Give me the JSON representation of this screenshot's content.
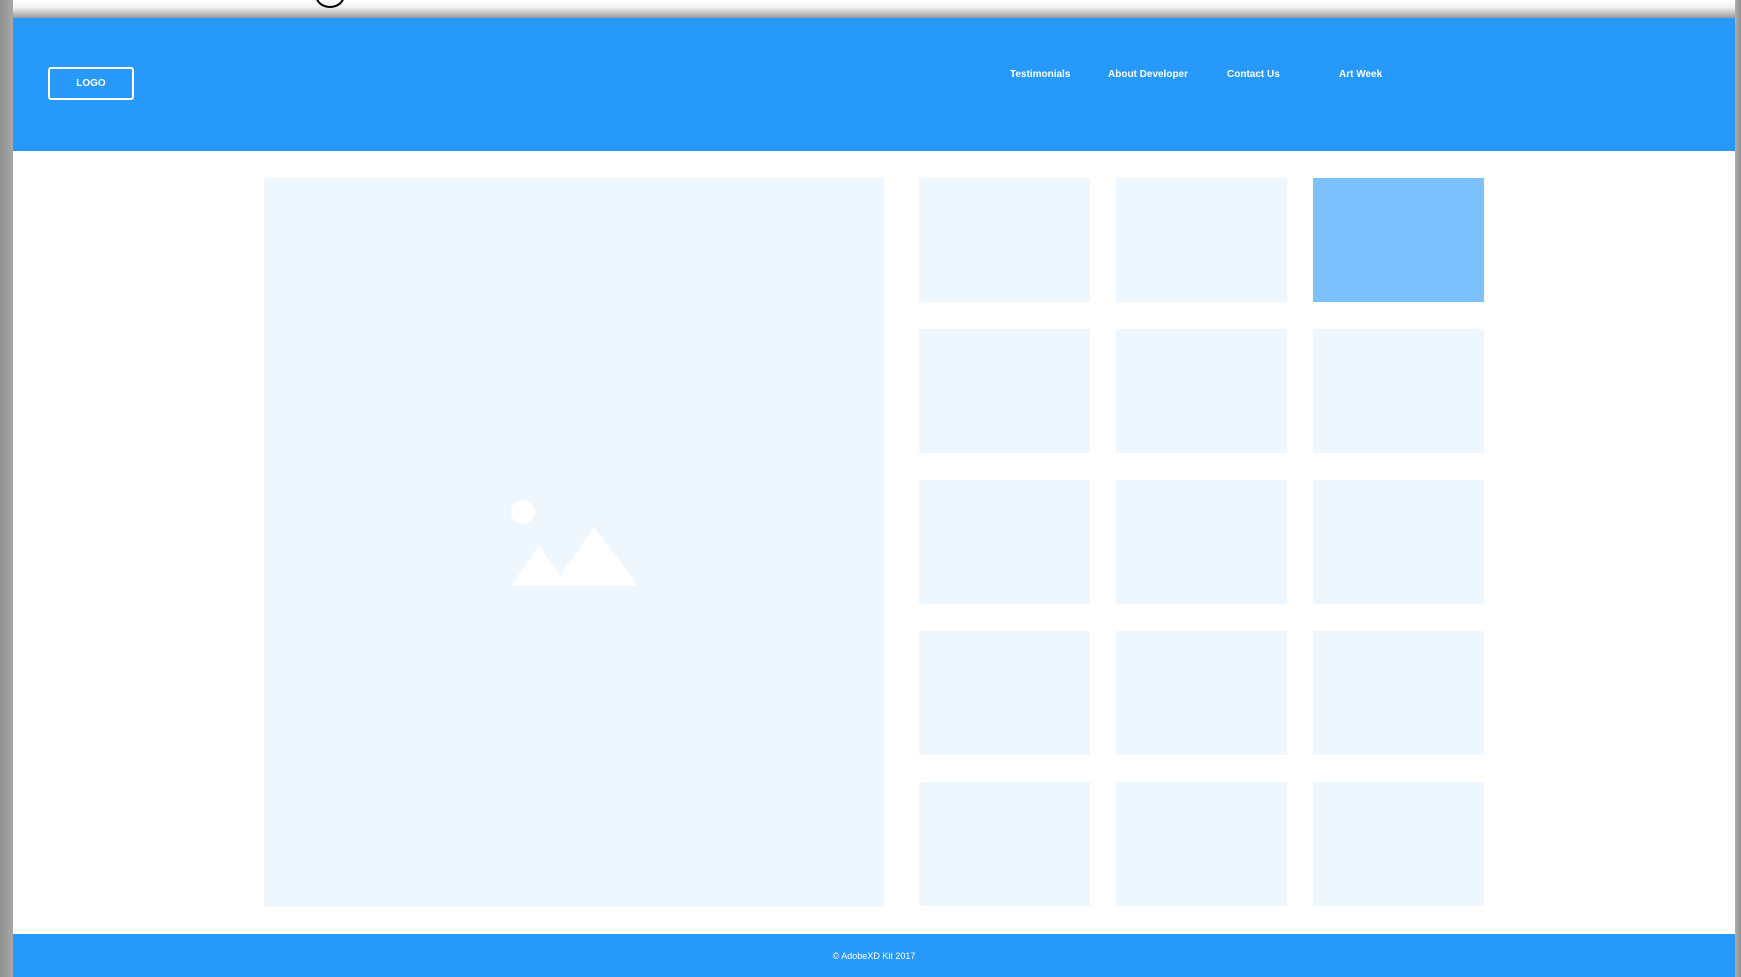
{
  "header": {
    "logo_label": "LOGO",
    "nav": [
      {
        "label": "Testimonials"
      },
      {
        "label": "About Developer"
      },
      {
        "label": "Contact Us"
      },
      {
        "label": "Art Week"
      }
    ]
  },
  "hero": {
    "icon": "image-placeholder-icon"
  },
  "grid": {
    "rows": 5,
    "cols": 3,
    "active_tile": 3
  },
  "footer": {
    "copyright": "© AdobeXD Kit 2017"
  },
  "colors": {
    "brand": "#2799fb",
    "placeholder": "#eef6fe",
    "active_tile": "#7cc0fc",
    "white": "#ffffff"
  }
}
